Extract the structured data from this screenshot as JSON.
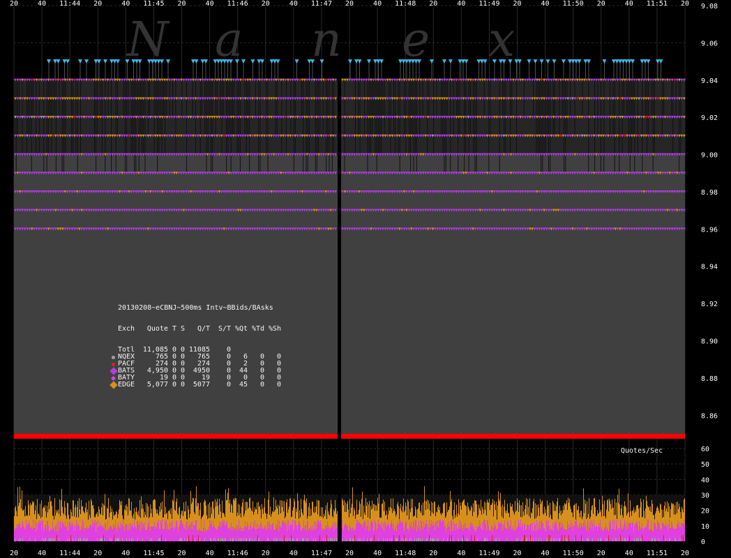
{
  "watermark": [
    "N",
    "a",
    "n",
    "e",
    "x"
  ],
  "colors": {
    "background": "#000000",
    "plot_area": "#404040",
    "nqex": "#a0a0a0",
    "pacf": "#e02020",
    "bats": "#b040e0",
    "baty": "#e040e0",
    "edge": "#d8901c",
    "bid_marker": "#40b8e8",
    "volume_bar": "#ff0000",
    "grid": "#2a2a2a"
  },
  "chart_data": [
    {
      "type": "scatter",
      "name_hint": "price",
      "x_tick_labels": [
        "20",
        "40",
        "11:44",
        "20",
        "40",
        "11:45",
        "20",
        "40",
        "11:46",
        "20",
        "40",
        "11:47",
        "20",
        "40",
        "11:48",
        "20",
        "40",
        "11:49",
        "20",
        "40",
        "11:50",
        "20",
        "40",
        "11:51",
        "20"
      ],
      "y_tick_labels": [
        "9.08",
        "9.06",
        "9.04",
        "9.02",
        "9.00",
        "8.98",
        "8.96",
        "8.94",
        "8.92",
        "8.90",
        "8.88",
        "8.86"
      ],
      "ylim": [
        8.85,
        9.08
      ],
      "quote_levels": [
        9.04,
        9.03,
        9.02,
        9.01,
        9.0,
        8.99,
        8.98,
        8.97,
        8.96
      ],
      "top_marker_level": 9.05,
      "gap_x_label": "11:47"
    },
    {
      "type": "bar",
      "name_hint": "quotes",
      "ylabel": "Quotes/Sec",
      "y_tick_labels": [
        "60",
        "50",
        "40",
        "30",
        "20",
        "10",
        "0"
      ],
      "ylim": [
        0,
        60
      ],
      "x_tick_labels": [
        "20",
        "40",
        "11:44",
        "20",
        "40",
        "11:45",
        "20",
        "40",
        "11:46",
        "20",
        "40",
        "11:47",
        "20",
        "40",
        "11:48",
        "20",
        "40",
        "11:49",
        "20",
        "40",
        "11:50",
        "20",
        "40",
        "11:51",
        "20"
      ]
    }
  ],
  "stats": {
    "title": "20130208~eCBNJ~500ms Intv~BBids/BAsks",
    "header": [
      "Exch",
      "Quote",
      "T",
      "S",
      "Q/T",
      "S/T",
      "%Qt",
      "%Td",
      "%Sh"
    ],
    "rows": [
      {
        "exch": "Totl",
        "quote": "11,085",
        "t": "0",
        "s": "0",
        "qt": "11085",
        "st": "0",
        "pqt": "",
        "ptd": "",
        "psh": "",
        "marker": "none",
        "color": ""
      },
      {
        "exch": "NQEX",
        "quote": "765",
        "t": "0",
        "s": "0",
        "qt": "765",
        "st": "0",
        "pqt": "6",
        "ptd": "0",
        "psh": "0",
        "marker": "dot",
        "color": "#a0a0a0"
      },
      {
        "exch": "PACF",
        "quote": "274",
        "t": "0",
        "s": "0",
        "qt": "274",
        "st": "0",
        "pqt": "2",
        "ptd": "0",
        "psh": "0",
        "marker": "dot",
        "color": "#e02020"
      },
      {
        "exch": "BATS",
        "quote": "4,950",
        "t": "0",
        "s": "0",
        "qt": "4950",
        "st": "0",
        "pqt": "44",
        "ptd": "0",
        "psh": "0",
        "marker": "diamond",
        "color": "#b040e0"
      },
      {
        "exch": "BATY",
        "quote": "19",
        "t": "0",
        "s": "0",
        "qt": "19",
        "st": "0",
        "pqt": "0",
        "ptd": "0",
        "psh": "0",
        "marker": "diamond-small",
        "color": "#e040e0"
      },
      {
        "exch": "EDGE",
        "quote": "5,077",
        "t": "0",
        "s": "0",
        "qt": "5077",
        "st": "0",
        "pqt": "45",
        "ptd": "0",
        "psh": "0",
        "marker": "diamond",
        "color": "#d8901c"
      }
    ]
  }
}
